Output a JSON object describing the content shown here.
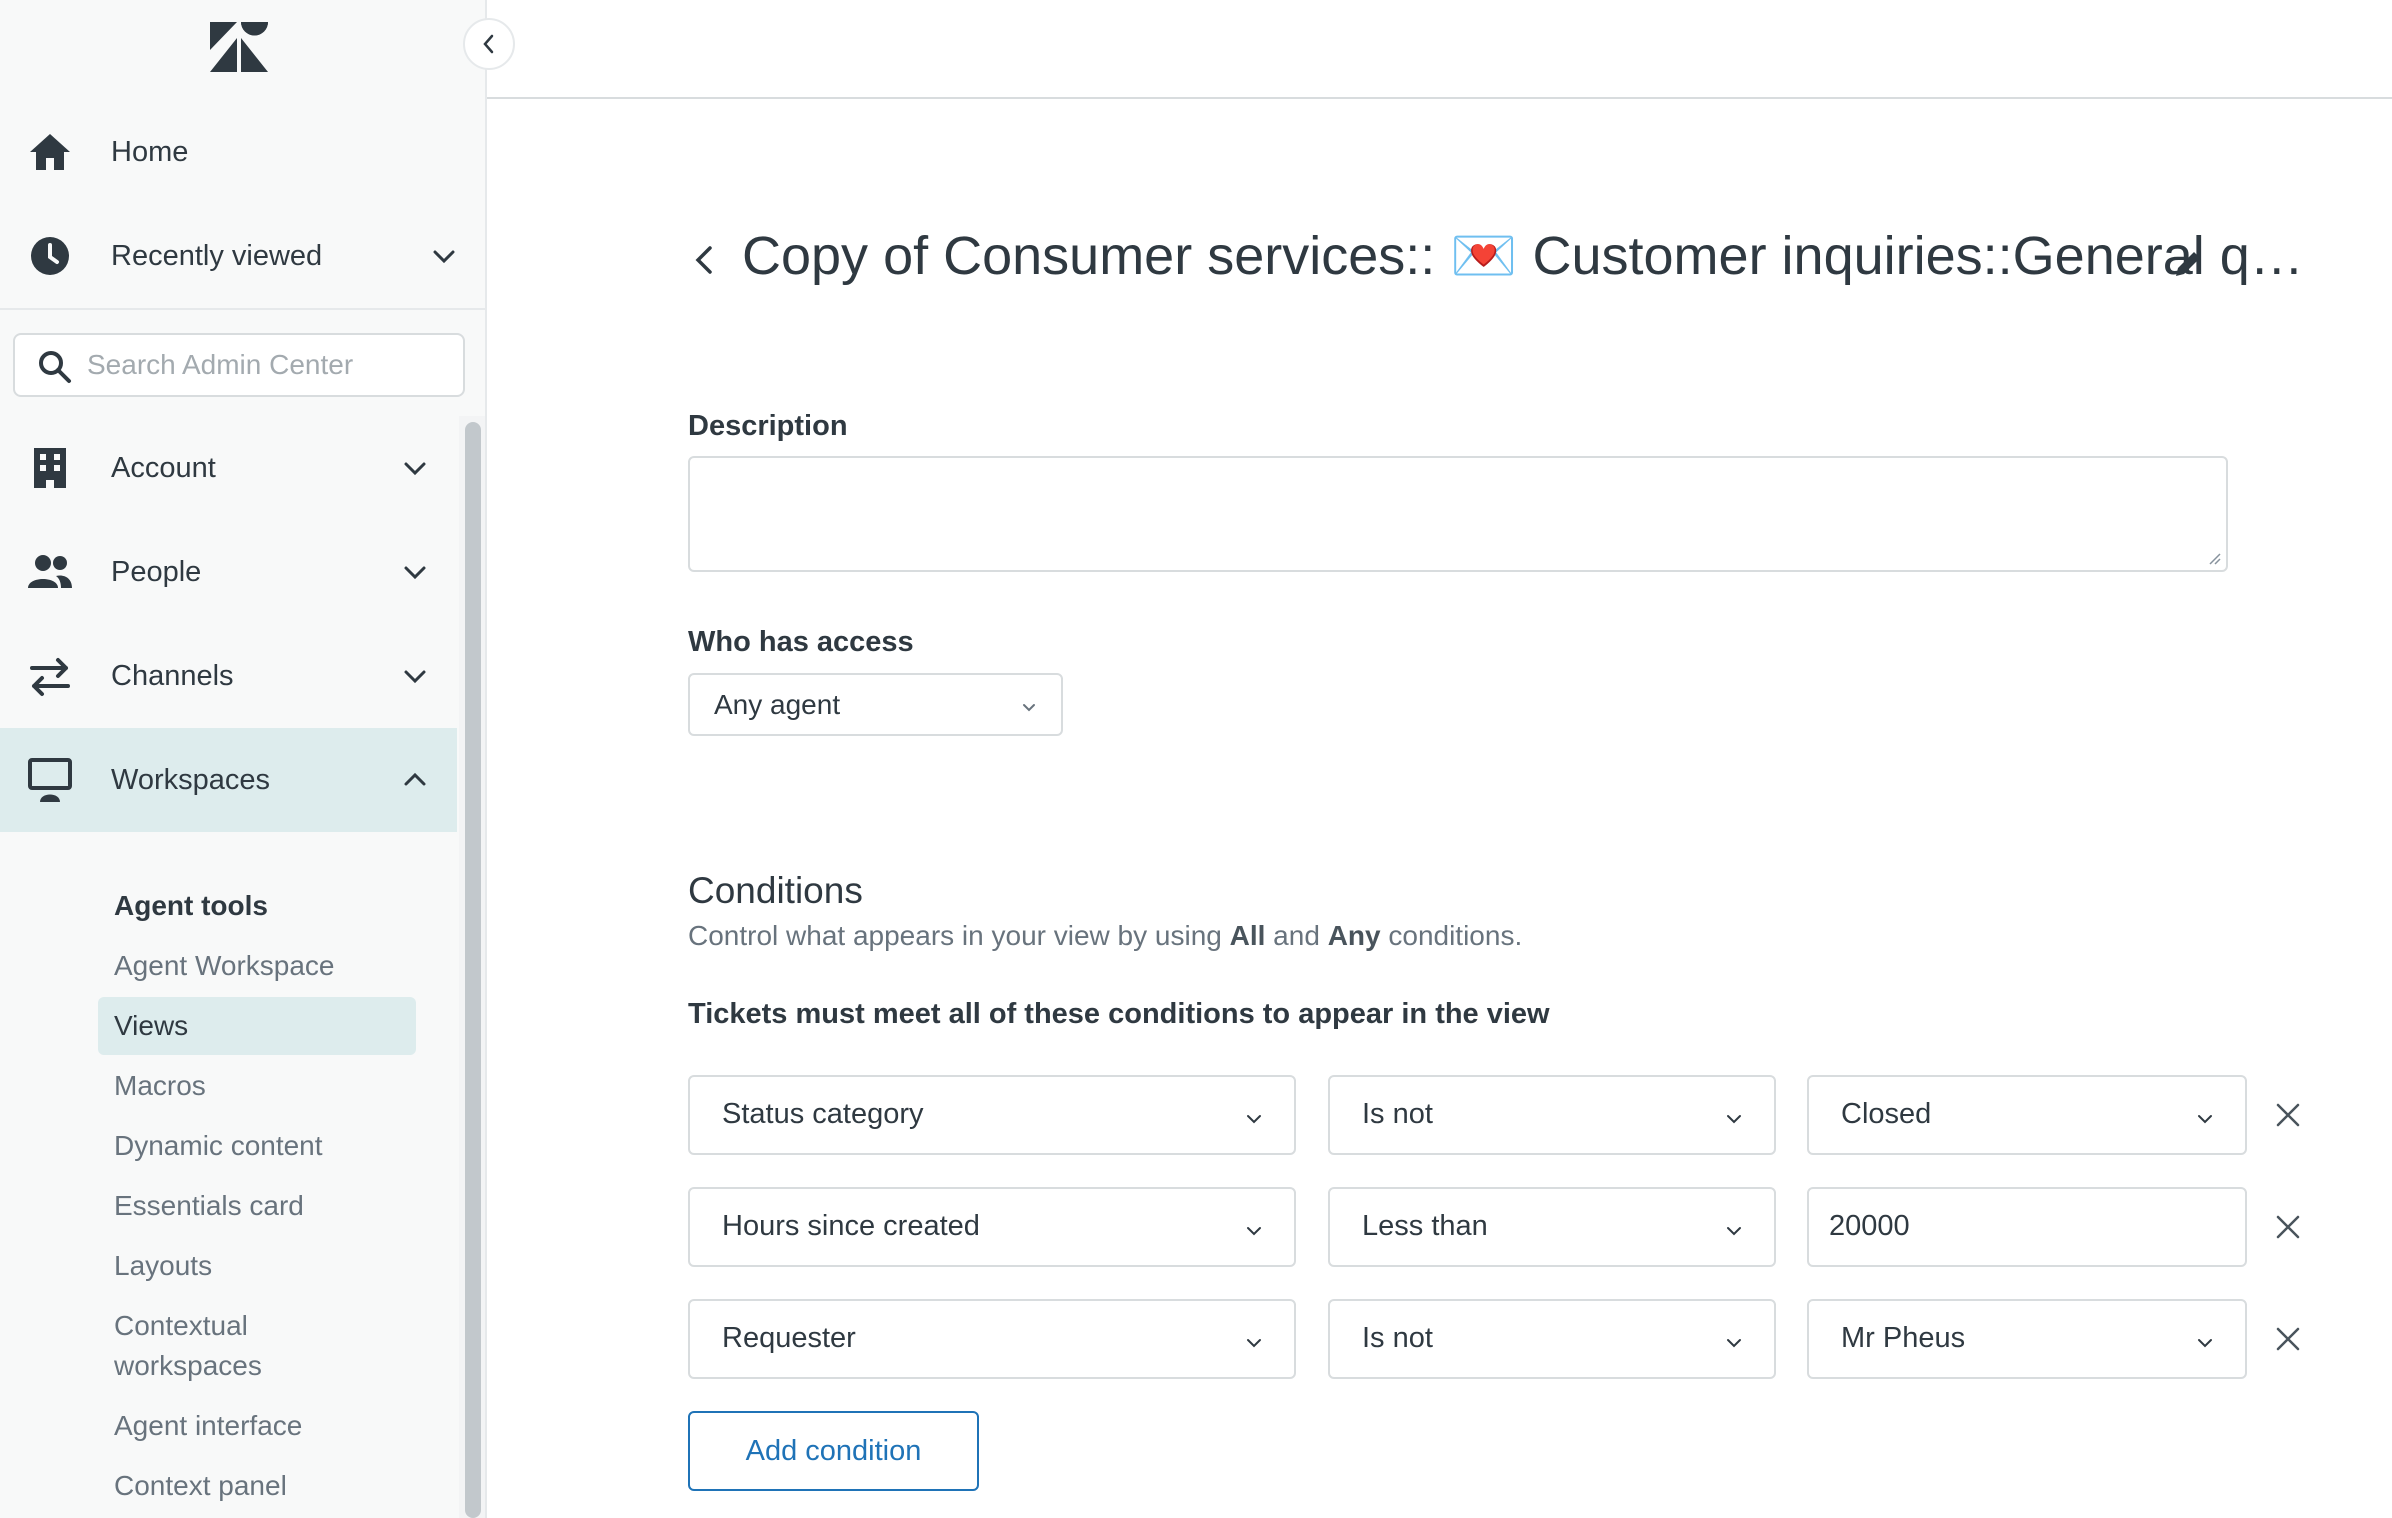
{
  "sidebar": {
    "logo": "zendesk-logo",
    "home_label": "Home",
    "recent_label": "Recently viewed",
    "search_placeholder": "Search Admin Center",
    "nav": [
      {
        "label": "Account",
        "icon": "building-icon"
      },
      {
        "label": "People",
        "icon": "people-icon"
      },
      {
        "label": "Channels",
        "icon": "arrows-icon"
      },
      {
        "label": "Workspaces",
        "icon": "monitor-icon"
      }
    ],
    "section_heading": "Agent tools",
    "sub_items": [
      {
        "label": "Agent Workspace"
      },
      {
        "label": "Views"
      },
      {
        "label": "Macros"
      },
      {
        "label": "Dynamic content"
      },
      {
        "label": "Essentials card"
      },
      {
        "label": "Layouts"
      },
      {
        "label": "Contextual workspaces"
      },
      {
        "label": "Agent interface"
      },
      {
        "label": "Context panel"
      }
    ]
  },
  "main": {
    "title": "Copy of Consumer services:: 💌 Customer inquiries::General q…",
    "description_label": "Description",
    "description_value": "",
    "access_label": "Who has access",
    "access_value": "Any agent",
    "conditions_title": "Conditions",
    "conditions_sub_1": "Control what appears in your view by using ",
    "conditions_sub_all": "All",
    "conditions_sub_2": " and ",
    "conditions_sub_any": "Any",
    "conditions_sub_3": " conditions.",
    "conditions_rule": "Tickets must meet all of these conditions to appear in the view",
    "conditions": [
      {
        "field": "Status category",
        "operator": "Is not",
        "value": "Closed"
      },
      {
        "field": "Hours since created",
        "operator": "Less than",
        "value": "20000"
      },
      {
        "field": "Requester",
        "operator": "Is not",
        "value": "Mr Pheus"
      }
    ],
    "add_condition_label": "Add condition"
  },
  "colors": {
    "accent": "#1f73b7",
    "active_bg": "#ddeced",
    "text": "#2f3941",
    "muted": "#68737d"
  }
}
